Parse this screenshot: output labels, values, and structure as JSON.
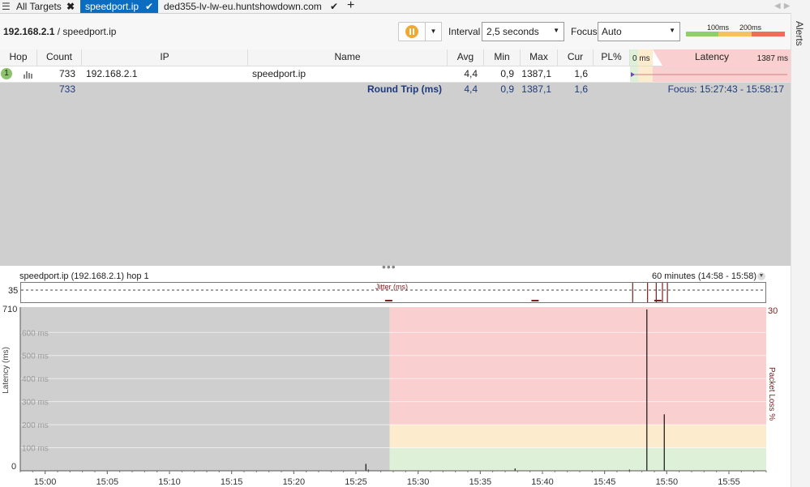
{
  "tabs": [
    {
      "label": "All Targets",
      "close_icon": "close-icon"
    },
    {
      "label": "speedport.ip",
      "status_icon": "check-icon"
    },
    {
      "label": "ded355-lv-lw-eu.huntshowdown.com",
      "status_icon": "check-icon"
    }
  ],
  "toolbar": {
    "target_ip": "192.168.2.1",
    "target_separator": " / ",
    "target_name": "speedport.ip",
    "interval_label": "Interval",
    "interval_value": "2,5 seconds",
    "focus_label": "Focus",
    "focus_value": "Auto",
    "legend_100": "100ms",
    "legend_200": "200ms",
    "colors": {
      "good": "#8fcf6a",
      "warn": "#f3c35c",
      "bad": "#ef6b5c",
      "pause": "#f0a830"
    }
  },
  "sidebar": {
    "label": "Alerts"
  },
  "grid": {
    "headers": {
      "hop": "Hop",
      "count": "Count",
      "ip": "IP",
      "name": "Name",
      "avg": "Avg",
      "min": "Min",
      "max": "Max",
      "cur": "Cur",
      "pl": "PL%",
      "latency": "Latency",
      "lat_min": "0 ms",
      "lat_max": "1387 ms"
    },
    "rows": [
      {
        "hop": "1",
        "count": "733",
        "ip": "192.168.2.1",
        "name": "speedport.ip",
        "avg": "4,4",
        "min": "0,9",
        "max": "1387,1",
        "cur": "1,6",
        "pl": ""
      }
    ],
    "summary": {
      "count": "733",
      "label": "Round Trip (ms)",
      "avg": "4,4",
      "min": "0,9",
      "max": "1387,1",
      "cur": "1,6",
      "focus": "Focus: 15:27:43 - 15:58:17"
    }
  },
  "graph": {
    "title": "speedport.ip (192.168.2.1) hop 1",
    "range": "60 minutes (14:58 - 15:58)",
    "jitter_label": "Jitter (ms)",
    "jitter_max": "35",
    "y_top": "710",
    "y_bottom": "0",
    "y_right_top": "30",
    "y_label": "Latency (ms)",
    "y_right_label": "Packet Loss %",
    "gridlines": [
      "600 ms",
      "500 ms",
      "400 ms",
      "300 ms",
      "200 ms",
      "100 ms"
    ],
    "x_ticks": [
      "15:00",
      "15:05",
      "15:10",
      "15:15",
      "15:20",
      "15:25",
      "15:30",
      "15:35",
      "15:40",
      "15:45",
      "15:50",
      "15:55"
    ]
  },
  "chart_data": {
    "type": "line",
    "title": "speedport.ip (192.168.2.1) hop 1",
    "xlabel": "",
    "ylabel": "Latency (ms)",
    "x_range": [
      "14:58",
      "15:58"
    ],
    "ylim": [
      0,
      710
    ],
    "y2_label": "Packet Loss %",
    "y2lim": [
      0,
      30
    ],
    "no_data_until": "15:27:43",
    "zones": [
      {
        "from": 0,
        "to": 100,
        "color": "#dff0d8"
      },
      {
        "from": 100,
        "to": 200,
        "color": "#fcebcd"
      },
      {
        "from": 200,
        "to": 710,
        "color": "#f9d0cf"
      }
    ],
    "series": [
      {
        "values_minutes": [
          15.0,
          27.8,
          28.0,
          39.8,
          49.0,
          50.4,
          51.8
        ],
        "values_ms": [
          0,
          30,
          5,
          10,
          5,
          700,
          245
        ]
      }
    ],
    "jitter_spikes_minutes": [
      49.3,
      50.5,
      51.2,
      51.7,
      52.1
    ]
  }
}
